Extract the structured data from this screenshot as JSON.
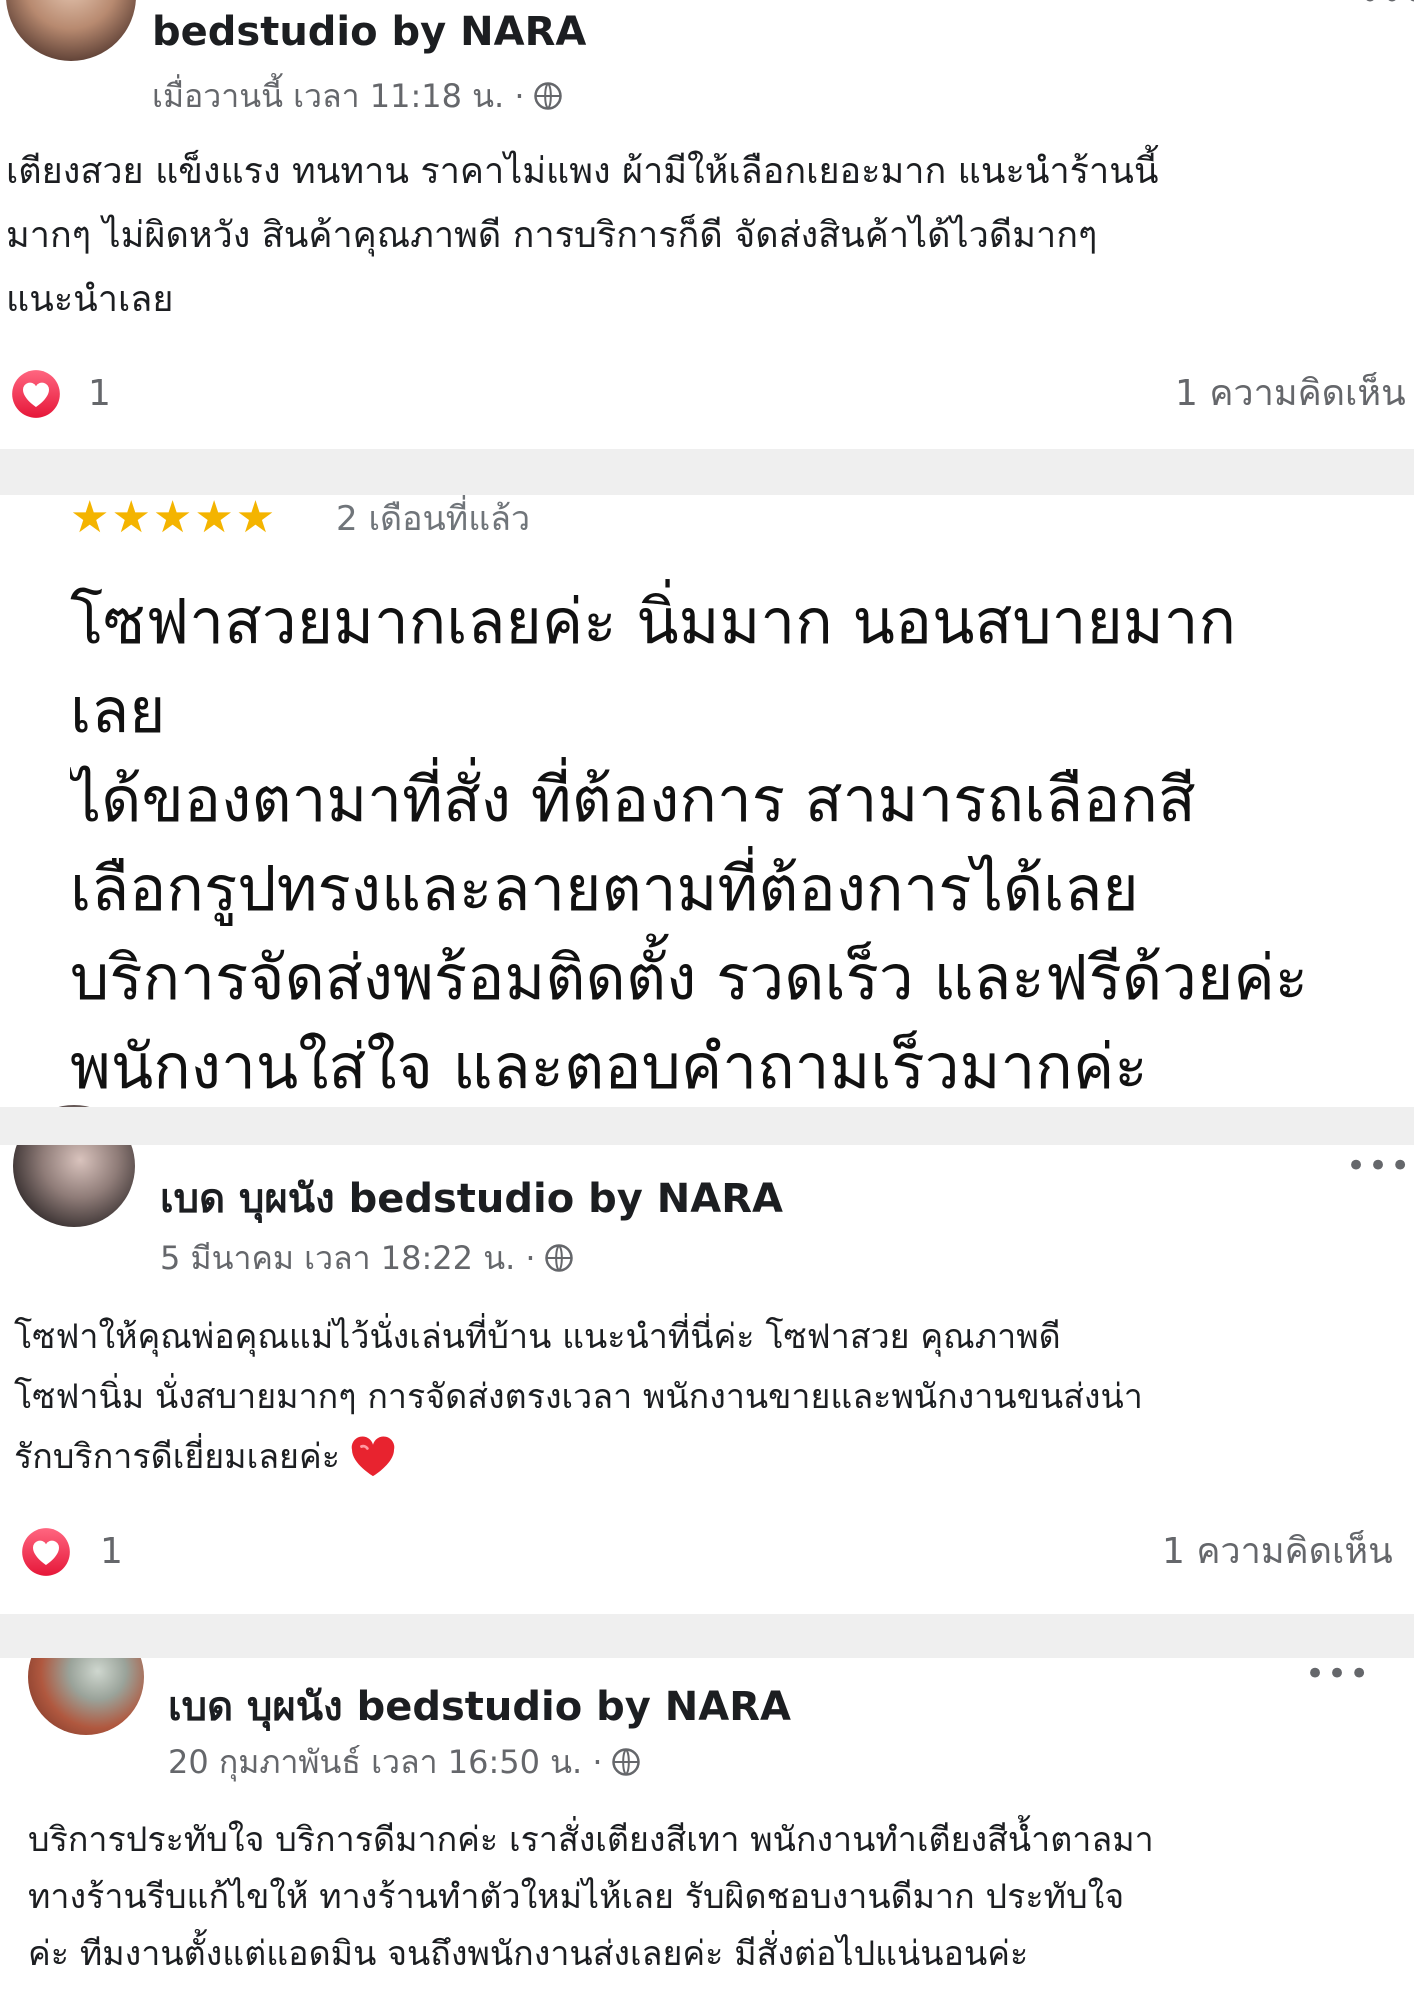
{
  "post_top": {
    "author": "bedstudio by NARA",
    "timestamp": "เมื่อวานนี้ เวลา 11:18 น. ·",
    "body": [
      "เตียงสวย แข็งแรง ทนทาน ราคาไม่แพง ผ้ามีให้เลือกเยอะมาก แนะนำร้านนี้",
      "มากๆ ไม่ผิดหวัง สินค้าคุณภาพดี การบริการก็ดี จัดส่งสินค้าได้ไวดีมากๆ",
      "แนะนำเลย"
    ],
    "reactions": "1",
    "comments": "1 ความคิดเห็น",
    "more_label": "•••"
  },
  "review": {
    "rating": 5,
    "stars": "★★★★★",
    "time": "2 เดือนที่แล้ว",
    "lines": [
      "โซฟาสวยมากเลยค่ะ นิ่มมาก นอนสบายมาก",
      "เลย",
      "ได้ของตามาที่สั่ง ที่ต้องการ สามารถเลือกสี",
      "เลือกรูปทรงและลายตามที่ต้องการได้เลย",
      "บริการจัดส่งพร้อมติดตั้ง รวดเร็ว และฟรีด้วยค่ะ",
      "พนักงานใส่ใจ และตอบคำถามเร็วมากค่ะ"
    ]
  },
  "post_middle": {
    "author": "เบด บุผนัง bedstudio by NARA",
    "timestamp": "5 มีนาคม เวลา 18:22 น. ·",
    "body": [
      "โซฟาให้คุณพ่อคุณแม่ไว้นั่งเล่นที่บ้าน แนะนำที่นี่ค่ะ โซฟาสวย คุณภาพดี",
      "โซฟานิ่ม นั่งสบายมากๆ การจัดส่งตรงเวลา พนักงานขายและพนักงานขนส่งน่า",
      "รักบริการดีเยี่ยมเลยค่ะ"
    ],
    "reactions": "1",
    "comments": "1 ความคิดเห็น",
    "more_label": "•••"
  },
  "post_bottom": {
    "author": "เบด บุผนัง bedstudio by NARA",
    "timestamp": "20 กุมภาพันธ์ เวลา 16:50 น. ·",
    "body": [
      "บริการประทับใจ  บริการดีมากค่ะ เราสั่งเตียงสีเทา พนักงานทำเตียงสีน้ำตาลมา",
      "ทางร้านรีบแก้ไขให้ ทางร้านทำตัวใหม่ไห้เลย  รับผิดชอบงานดีมาก  ประทับใจ",
      "ค่ะ ทีมงานตั้งแต่แอดมิน จนถึงพนักงานส่งเลยค่ะ มีสั่งต่อไปแน่นอนค่ะ"
    ],
    "more_label": "•••"
  },
  "colors": {
    "heart_reaction": "#f33e58",
    "star": "#f4b400",
    "meta_text": "#65676b",
    "divider": "#efefef"
  },
  "icons": {
    "globe": "globe-icon",
    "reaction": "love-reaction-icon",
    "emoji": "red-heart-emoji-icon",
    "more": "more-options-icon"
  }
}
